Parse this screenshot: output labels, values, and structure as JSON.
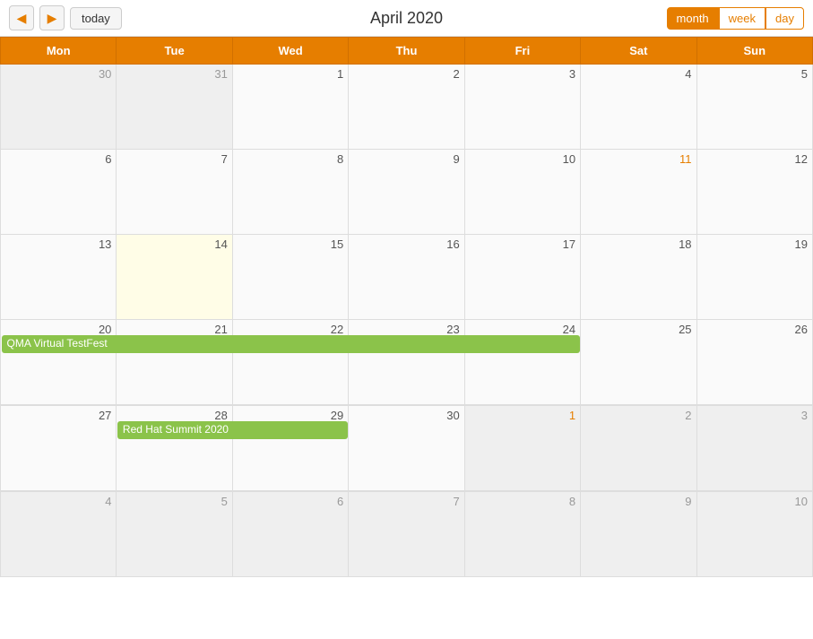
{
  "header": {
    "title": "April 2020",
    "today_label": "today",
    "prev_label": "◀",
    "next_label": "▶",
    "views": [
      "month",
      "week",
      "day"
    ],
    "active_view": "month"
  },
  "calendar": {
    "days_of_week": [
      "Mon",
      "Tue",
      "Wed",
      "Thu",
      "Fri",
      "Sat",
      "Sun"
    ],
    "weeks": [
      {
        "days": [
          {
            "num": "30",
            "in_month": false,
            "today": false
          },
          {
            "num": "31",
            "in_month": false,
            "today": false
          },
          {
            "num": "1",
            "in_month": true,
            "today": false
          },
          {
            "num": "2",
            "in_month": true,
            "today": false
          },
          {
            "num": "3",
            "in_month": true,
            "today": false
          },
          {
            "num": "4",
            "in_month": true,
            "today": false
          },
          {
            "num": "5",
            "in_month": true,
            "today": false
          }
        ],
        "events": []
      },
      {
        "days": [
          {
            "num": "6",
            "in_month": true,
            "today": false
          },
          {
            "num": "7",
            "in_month": true,
            "today": false
          },
          {
            "num": "8",
            "in_month": true,
            "today": false
          },
          {
            "num": "9",
            "in_month": true,
            "today": false
          },
          {
            "num": "10",
            "in_month": true,
            "today": false
          },
          {
            "num": "11",
            "in_month": true,
            "today": false,
            "orange": true
          },
          {
            "num": "12",
            "in_month": true,
            "today": false
          }
        ],
        "events": []
      },
      {
        "days": [
          {
            "num": "13",
            "in_month": true,
            "today": false
          },
          {
            "num": "14",
            "in_month": true,
            "today": true
          },
          {
            "num": "15",
            "in_month": true,
            "today": false
          },
          {
            "num": "16",
            "in_month": true,
            "today": false
          },
          {
            "num": "17",
            "in_month": true,
            "today": false
          },
          {
            "num": "18",
            "in_month": true,
            "today": false
          },
          {
            "num": "19",
            "in_month": true,
            "today": false
          }
        ],
        "events": []
      },
      {
        "days": [
          {
            "num": "20",
            "in_month": true,
            "today": false
          },
          {
            "num": "21",
            "in_month": true,
            "today": false
          },
          {
            "num": "22",
            "in_month": true,
            "today": false
          },
          {
            "num": "23",
            "in_month": true,
            "today": false
          },
          {
            "num": "24",
            "in_month": true,
            "today": false
          },
          {
            "num": "25",
            "in_month": true,
            "today": false
          },
          {
            "num": "26",
            "in_month": true,
            "today": false
          }
        ],
        "events": [
          {
            "label": "QMA Virtual TestFest",
            "color": "green",
            "start_col": 0,
            "span": 5
          }
        ]
      },
      {
        "days": [
          {
            "num": "27",
            "in_month": true,
            "today": false
          },
          {
            "num": "28",
            "in_month": true,
            "today": false
          },
          {
            "num": "29",
            "in_month": true,
            "today": false
          },
          {
            "num": "30",
            "in_month": true,
            "today": false
          },
          {
            "num": "1",
            "in_month": false,
            "today": false,
            "orange": true
          },
          {
            "num": "2",
            "in_month": false,
            "today": false
          },
          {
            "num": "3",
            "in_month": false,
            "today": false
          }
        ],
        "events": [
          {
            "label": "Red Hat Summit 2020",
            "color": "green",
            "start_col": 1,
            "span": 2
          }
        ]
      },
      {
        "days": [
          {
            "num": "4",
            "in_month": false,
            "today": false
          },
          {
            "num": "5",
            "in_month": false,
            "today": false
          },
          {
            "num": "6",
            "in_month": false,
            "today": false
          },
          {
            "num": "7",
            "in_month": false,
            "today": false
          },
          {
            "num": "8",
            "in_month": false,
            "today": false
          },
          {
            "num": "9",
            "in_month": false,
            "today": false
          },
          {
            "num": "10",
            "in_month": false,
            "today": false
          }
        ],
        "events": []
      }
    ]
  }
}
